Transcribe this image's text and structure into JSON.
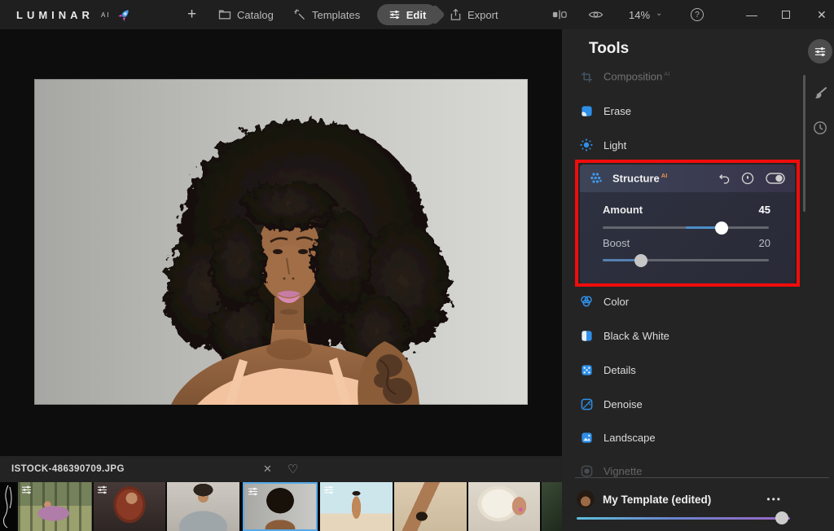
{
  "topbar": {
    "logo": "LUMINAR",
    "logo_sup": "AI",
    "plus": "+",
    "catalog": "Catalog",
    "templates": "Templates",
    "edit": "Edit",
    "export": "Export",
    "zoom": "14%",
    "chevron": "⌄",
    "help": "?",
    "minimize": "—",
    "close": "✕"
  },
  "tools": {
    "title": "Tools",
    "items": [
      {
        "label": "Composition",
        "sup": "AI",
        "state": "disabled"
      },
      {
        "label": "Erase",
        "state": "normal"
      },
      {
        "label": "Light",
        "state": "normal"
      },
      {
        "label": "Structure",
        "sup": "AI",
        "state": "active"
      },
      {
        "label": "Color",
        "state": "normal"
      },
      {
        "label": "Black & White",
        "state": "normal"
      },
      {
        "label": "Details",
        "state": "normal"
      },
      {
        "label": "Denoise",
        "state": "normal"
      },
      {
        "label": "Landscape",
        "state": "normal"
      },
      {
        "label": "Vignette",
        "state": "dimmed"
      }
    ],
    "structure_panel": {
      "sliders": [
        {
          "label": "Amount",
          "value": "45"
        },
        {
          "label": "Boost",
          "value": "20"
        }
      ]
    }
  },
  "template_bar": {
    "label": "My Template (edited)",
    "menu": "•••"
  },
  "filebar": {
    "filename": "ISTOCK-486390709.JPG",
    "close": "✕",
    "favorite": "♡"
  },
  "colors": {
    "accent_blue": "#2f8fe8",
    "annotation_red": "#f10c0c",
    "slider_fill": "#4d8ec9",
    "selected_thumb_border": "#56a8e8"
  }
}
